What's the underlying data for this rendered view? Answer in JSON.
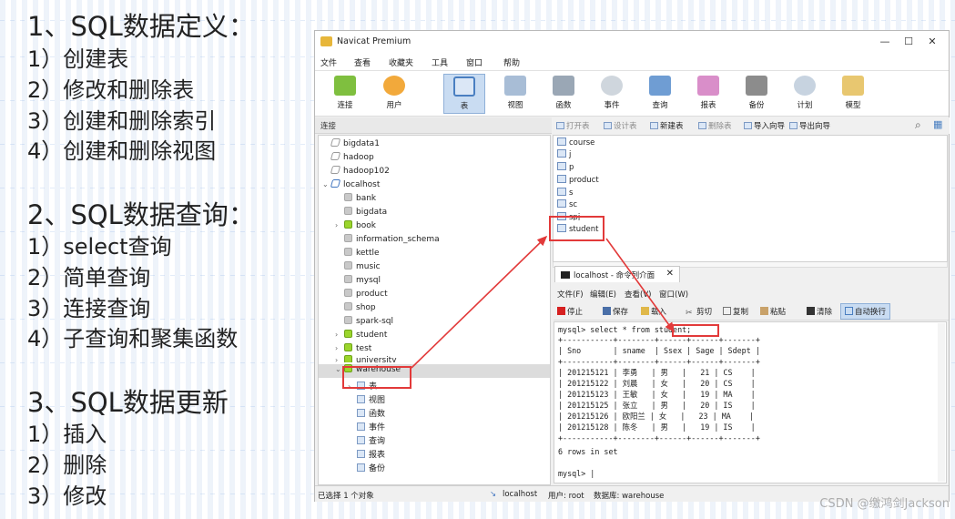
{
  "slide": {
    "section1": {
      "title": "1、SQL数据定义：",
      "items": [
        "1）创建表",
        "2）修改和删除表",
        "3）创建和删除索引",
        "4）创建和删除视图"
      ]
    },
    "section2": {
      "title": "2、SQL数据查询：",
      "items": [
        "1）select查询",
        "2）简单查询",
        "3）连接查询",
        "4）子查询和聚集函数"
      ]
    },
    "section3": {
      "title": "3、SQL数据更新",
      "items": [
        "1）插入",
        "2）删除",
        "3）修改"
      ]
    }
  },
  "window": {
    "title": "Navicat Premium",
    "controls": {
      "minimize": "—",
      "maximize": "☐",
      "close": "✕"
    },
    "menu": [
      "文件",
      "查看",
      "收藏夹",
      "工具",
      "窗口",
      "帮助"
    ],
    "toolbar": [
      "连接",
      "用户",
      "表",
      "视图",
      "函数",
      "事件",
      "查询",
      "报表",
      "备份",
      "计划",
      "模型"
    ],
    "connection_header": "连接",
    "object_toolbar": [
      "打开表",
      "设计表",
      "新建表",
      "删除表",
      "导入向导",
      "导出向导"
    ]
  },
  "tree": {
    "connections_top": [
      "bigdata1",
      "hadoop",
      "hadoop102"
    ],
    "localhost": "localhost",
    "databases": [
      "bank",
      "bigdata",
      "book",
      "information_schema",
      "kettle",
      "music",
      "mysql",
      "product",
      "shop",
      "spark-sql",
      "student",
      "test",
      "university"
    ],
    "warehouse": "warehouse",
    "warehouse_children": [
      "表",
      "视图",
      "函数",
      "事件",
      "查询",
      "报表",
      "备份"
    ]
  },
  "tables": [
    "course",
    "j",
    "p",
    "product",
    "s",
    "sc",
    "spj",
    "student"
  ],
  "console": {
    "tab": "localhost - 命令列介面",
    "close": "✕",
    "menu": [
      "文件(F)",
      "编辑(E)",
      "查看(V)",
      "窗口(W)"
    ],
    "tools": [
      "停止",
      "保存",
      "载入",
      "剪切",
      "复制",
      "粘贴",
      "清除",
      "自动换行"
    ],
    "prompt_cmd": "mysql> select * from ",
    "cmd_table": "student;",
    "border": "+-----------+--------+------+------+-------+",
    "header": "| Sno       | sname  | Ssex | Sage | Sdept |",
    "rows": [
      "| 201215121 | 李勇   | 男   |   21 | CS    |",
      "| 201215122 | 刘晨   | 女   |   20 | CS    |",
      "| 201215123 | 王敏   | 女   |   19 | MA    |",
      "| 201215125 | 张立   | 男   |   20 | IS    |",
      "| 201215126 | 欧阳兰 | 女   |   23 | MA    |",
      "| 201215128 | 陈冬   | 男   |   19 | IS    |"
    ],
    "rowcount": "6 rows in set",
    "prompt_end": "mysql> |"
  },
  "status": {
    "selected": "已选择 1 个对象",
    "conn": "localhost",
    "user": "用户: root",
    "db": "数据库: warehouse"
  },
  "watermark": "CSDN @缴鸿剑Jackson",
  "colors": {
    "accent": "#c9dcf2",
    "annotation": "#e23a3a"
  }
}
